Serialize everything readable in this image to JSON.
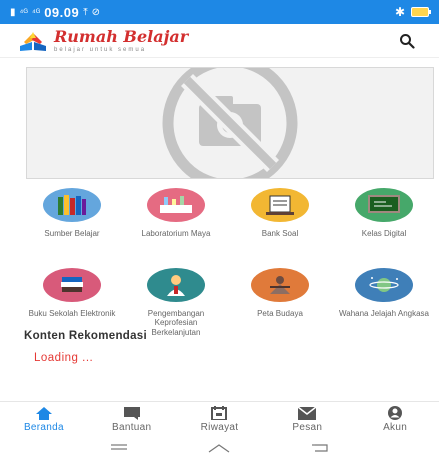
{
  "status_bar": {
    "signal_text": "⁴ᴳ",
    "signal_text_2": "⁴ᴳ",
    "time": "09.09"
  },
  "header": {
    "brand_name": "Rumah Belajar",
    "brand_tagline": "belajar untuk semua",
    "search_icon": "search-icon"
  },
  "banner": {
    "image_icon": "no-image-icon"
  },
  "menu": {
    "items": [
      {
        "label": "Sumber Belajar",
        "icon": "books-icon",
        "color": "#64a6dd"
      },
      {
        "label": "Laboratorium Maya",
        "icon": "laboratory-icon",
        "color": "#e56b82"
      },
      {
        "label": "Bank Soal",
        "icon": "exam-board-icon",
        "color": "#f2b733"
      },
      {
        "label": "Kelas Digital",
        "icon": "digital-class-icon",
        "color": "#46a86a"
      },
      {
        "label": "Buku Sekolah Elektronik",
        "icon": "ebook-icon",
        "color": "#d85a7a"
      },
      {
        "label": "Pengembangan Keprofesian Berkelanjutan",
        "icon": "teacher-icon",
        "color": "#2f8b8e"
      },
      {
        "label": "Peta Budaya",
        "icon": "culture-map-icon",
        "color": "#e07a3a"
      },
      {
        "label": "Wahana Jelajah Angkasa",
        "icon": "planet-icon",
        "color": "#3f7fb8"
      }
    ]
  },
  "content": {
    "section_title": "Konten Rekomendasi",
    "loading": "Loading ..."
  },
  "bottom_nav": {
    "items": [
      {
        "label": "Beranda",
        "icon": "home-icon"
      },
      {
        "label": "Bantuan",
        "icon": "chat-icon"
      },
      {
        "label": "Riwayat",
        "icon": "calendar-icon"
      },
      {
        "label": "Pesan",
        "icon": "mail-icon"
      },
      {
        "label": "Akun",
        "icon": "account-icon"
      }
    ],
    "active_color": "#1e88e5",
    "inactive_color": "#666666"
  },
  "colors": {
    "status_bar": "#1e88e5",
    "brand": "#d32f2f",
    "loading": "#e53935"
  }
}
